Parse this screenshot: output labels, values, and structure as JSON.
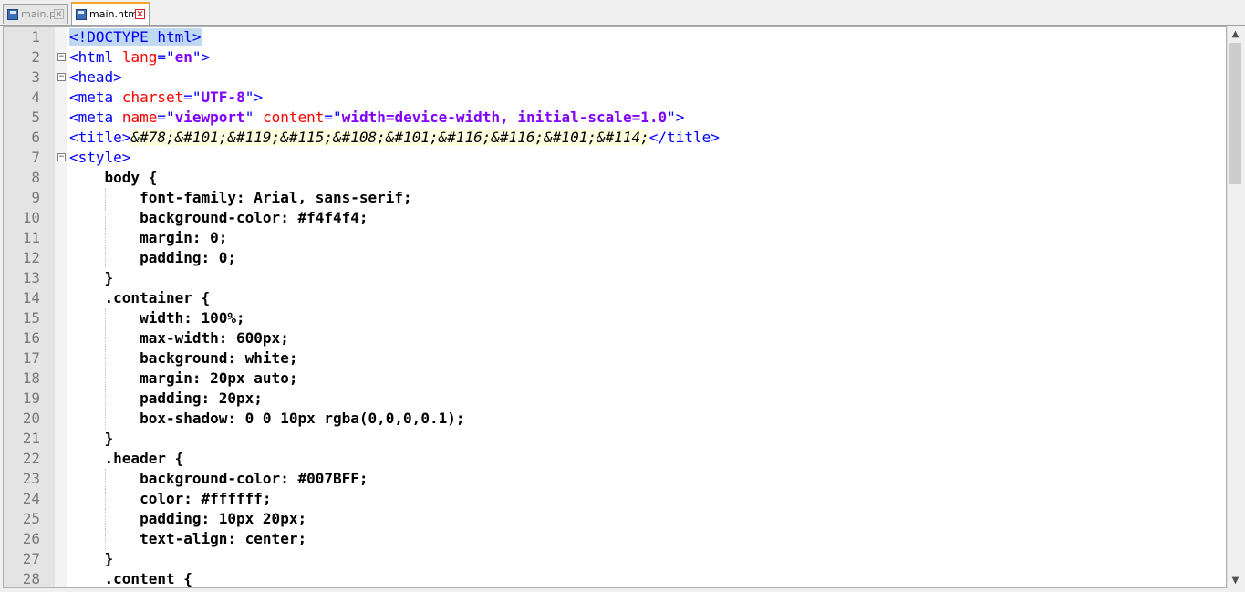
{
  "tabs": [
    {
      "label": "main.py",
      "active": false
    },
    {
      "label": "main.html",
      "active": true
    }
  ],
  "editor": {
    "lines": [
      {
        "n": "1",
        "text": "<!DOCTYPE html>"
      },
      {
        "n": "2",
        "text": "<html lang=\"en\">"
      },
      {
        "n": "3",
        "text": "<head>"
      },
      {
        "n": "4",
        "text": "<meta charset=\"UTF-8\">"
      },
      {
        "n": "5",
        "text": "<meta name=\"viewport\" content=\"width=device-width, initial-scale=1.0\">"
      },
      {
        "n": "6",
        "text": "<title>&#78;&#101;&#119;&#115;&#108;&#101;&#116;&#116;&#101;&#114;</title>"
      },
      {
        "n": "7",
        "text": "<style>"
      },
      {
        "n": "8",
        "text": "    body {"
      },
      {
        "n": "9",
        "text": "        font-family: Arial, sans-serif;"
      },
      {
        "n": "10",
        "text": "        background-color: #f4f4f4;"
      },
      {
        "n": "11",
        "text": "        margin: 0;"
      },
      {
        "n": "12",
        "text": "        padding: 0;"
      },
      {
        "n": "13",
        "text": "    }"
      },
      {
        "n": "14",
        "text": "    .container {"
      },
      {
        "n": "15",
        "text": "        width: 100%;"
      },
      {
        "n": "16",
        "text": "        max-width: 600px;"
      },
      {
        "n": "17",
        "text": "        background: white;"
      },
      {
        "n": "18",
        "text": "        margin: 20px auto;"
      },
      {
        "n": "19",
        "text": "        padding: 20px;"
      },
      {
        "n": "20",
        "text": "        box-shadow: 0 0 10px rgba(0,0,0,0.1);"
      },
      {
        "n": "21",
        "text": "    }"
      },
      {
        "n": "22",
        "text": "    .header {"
      },
      {
        "n": "23",
        "text": "        background-color: #007BFF;"
      },
      {
        "n": "24",
        "text": "        color: #ffffff;"
      },
      {
        "n": "25",
        "text": "        padding: 10px 20px;"
      },
      {
        "n": "26",
        "text": "        text-align: center;"
      },
      {
        "n": "27",
        "text": "    }"
      },
      {
        "n": "28",
        "text": "    .content {"
      }
    ]
  },
  "colors": {
    "tag": "#0000ff",
    "attribute": "#ff0000",
    "value": "#8000ff",
    "active_tab_accent": "#f5a623"
  }
}
